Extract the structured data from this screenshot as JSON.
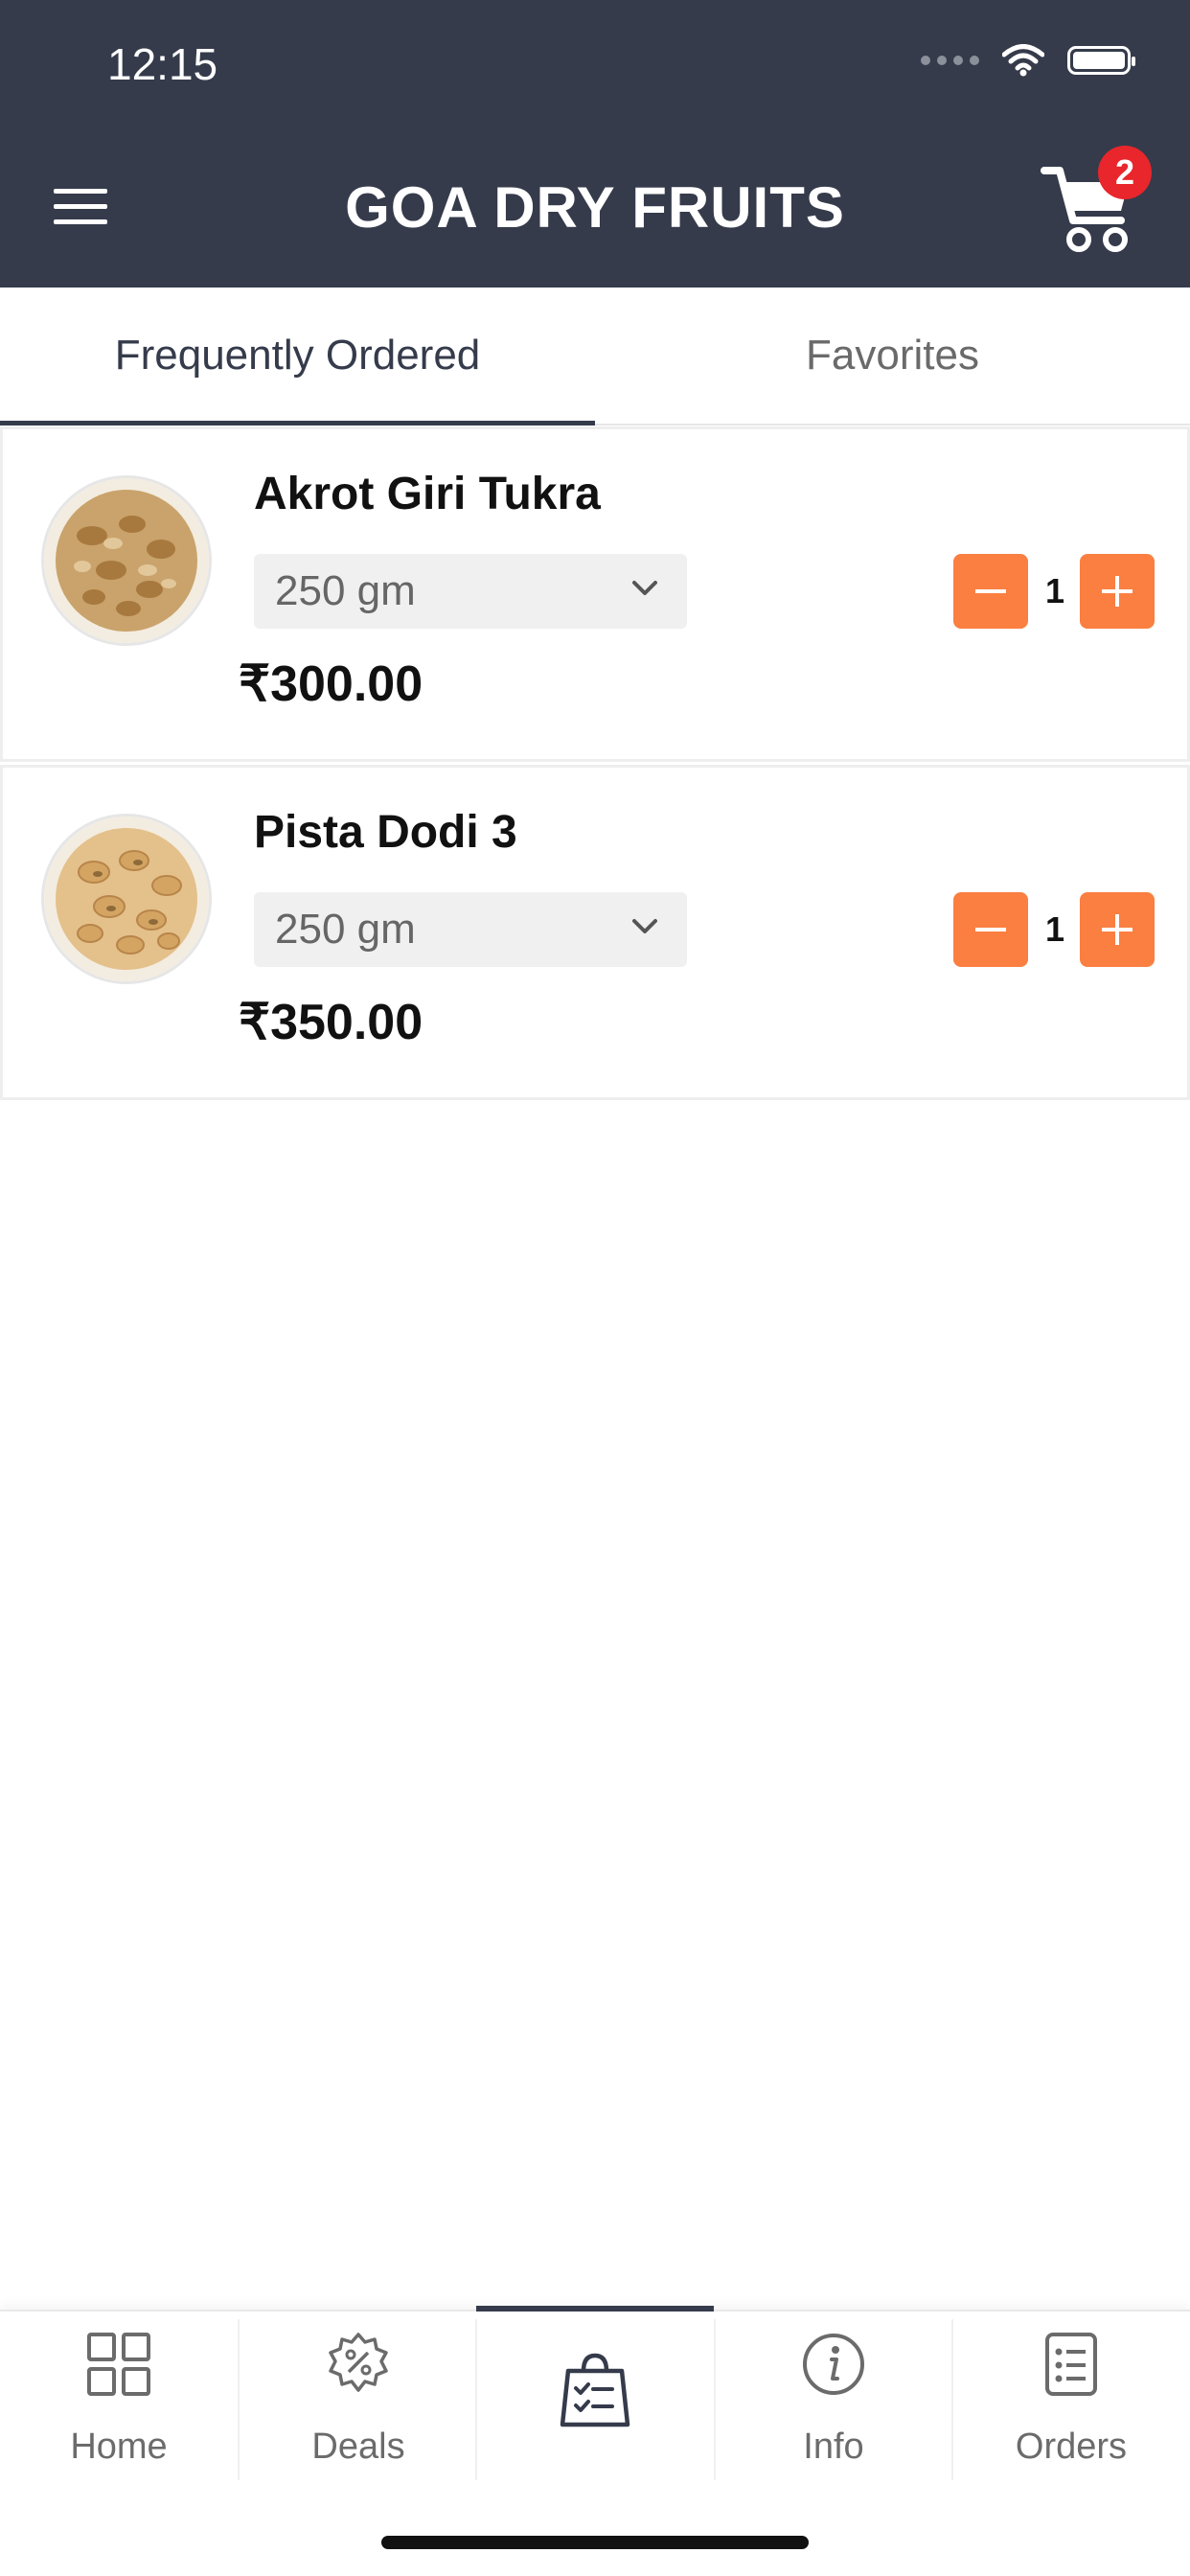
{
  "status_bar": {
    "time": "12:15"
  },
  "header": {
    "title": "GOA DRY FRUITS",
    "cart_count": "2"
  },
  "tabs": [
    {
      "label": "Frequently Ordered",
      "active": true
    },
    {
      "label": "Favorites",
      "active": false
    }
  ],
  "products": [
    {
      "name": "Akrot Giri Tukra",
      "weight": "250 gm",
      "qty": "1",
      "price": "₹300.00"
    },
    {
      "name": "Pista Dodi 3",
      "weight": "250 gm",
      "qty": "1",
      "price": "₹350.00"
    }
  ],
  "bottom_nav": [
    {
      "label": "Home",
      "icon": "grid-icon"
    },
    {
      "label": "Deals",
      "icon": "discount-badge-icon"
    },
    {
      "label": "",
      "icon": "shopping-bag-checklist-icon",
      "active": true
    },
    {
      "label": "Info",
      "icon": "info-icon"
    },
    {
      "label": "Orders",
      "icon": "orders-list-icon"
    }
  ],
  "colors": {
    "header_bg": "#353b4b",
    "accent": "#fa7f41",
    "badge": "#e8262b"
  }
}
